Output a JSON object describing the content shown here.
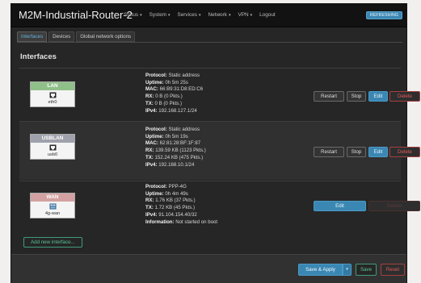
{
  "header": {
    "brand": "M2M-Industrial-Router-2",
    "menu": [
      {
        "label": "Status",
        "caret": "▾"
      },
      {
        "label": "System",
        "caret": "▾"
      },
      {
        "label": "Services",
        "caret": "▾"
      },
      {
        "label": "Network",
        "caret": "▾"
      },
      {
        "label": "VPN",
        "caret": "▾"
      },
      {
        "label": "Logout",
        "caret": ""
      }
    ],
    "refresh_badge": "REFRESHING"
  },
  "tabs": [
    "Interfaces",
    "Devices",
    "Global network options"
  ],
  "section_title": "Interfaces",
  "icons": {
    "ethernet": "ethernet-port-icon",
    "modem": "modem-icon"
  },
  "colors": {
    "lan": "#90c08a",
    "usblan": "#9fa2ad",
    "wan": "#d3a1a1",
    "accent": "#3a87b3"
  },
  "interfaces": [
    {
      "name": "LAN",
      "device": "eth0",
      "info": [
        {
          "k": "Protocol:",
          "v": "Static address"
        },
        {
          "k": "Uptime:",
          "v": "0h 5m 25s"
        },
        {
          "k": "MAC:",
          "v": "66:B9:31:D8:ED:C6"
        },
        {
          "k": "RX:",
          "v": "0 B (0 Pkts.)"
        },
        {
          "k": "TX:",
          "v": "0 B (0 Pkts.)"
        },
        {
          "k": "IPv4:",
          "v": "192.168.127.1/24"
        }
      ],
      "buttons": {
        "restart": "Restart",
        "stop": "Stop",
        "edit": "Edit",
        "delete": "Delete"
      }
    },
    {
      "name": "USBLAN",
      "device": "usb0",
      "info": [
        {
          "k": "Protocol:",
          "v": "Static address"
        },
        {
          "k": "Uptime:",
          "v": "0h 5m 19s"
        },
        {
          "k": "MAC:",
          "v": "62:81:28:BF:1F:87"
        },
        {
          "k": "RX:",
          "v": "139.59 KB (1123 Pkts.)"
        },
        {
          "k": "TX:",
          "v": "152.24 KB (475 Pkts.)"
        },
        {
          "k": "IPv4:",
          "v": "192.168.10.1/24"
        }
      ],
      "buttons": {
        "restart": "Restart",
        "stop": "Stop",
        "edit": "Edit",
        "delete": "Delete"
      }
    },
    {
      "name": "WAN",
      "device": "4g-wan",
      "info": [
        {
          "k": "Protocol:",
          "v": "PPP-4G"
        },
        {
          "k": "Uptime:",
          "v": "0h 4m 49s"
        },
        {
          "k": "RX:",
          "v": "1.76 KB (37 Pkts.)"
        },
        {
          "k": "TX:",
          "v": "1.72 KB (45 Pkts.)"
        },
        {
          "k": "IPv4:",
          "v": "91.104.154.40/32"
        },
        {
          "k": "Information:",
          "v": "Not started on boot"
        }
      ],
      "buttons": {
        "edit": "Edit",
        "delete": "Delete"
      }
    }
  ],
  "add_interface": "Add new interface...",
  "footer": {
    "save_apply": "Save & Apply",
    "dropdown": "▾",
    "save": "Save",
    "reset": "Reset"
  }
}
